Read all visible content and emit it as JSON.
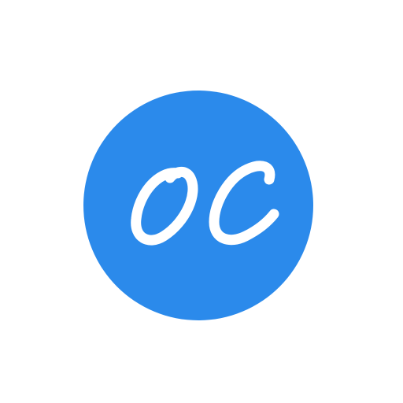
{
  "logo": {
    "monogram": "OC",
    "colors": {
      "circle": "#2B8AEB",
      "letters": "#FFFFFF",
      "background": "#FFFFFF"
    }
  }
}
